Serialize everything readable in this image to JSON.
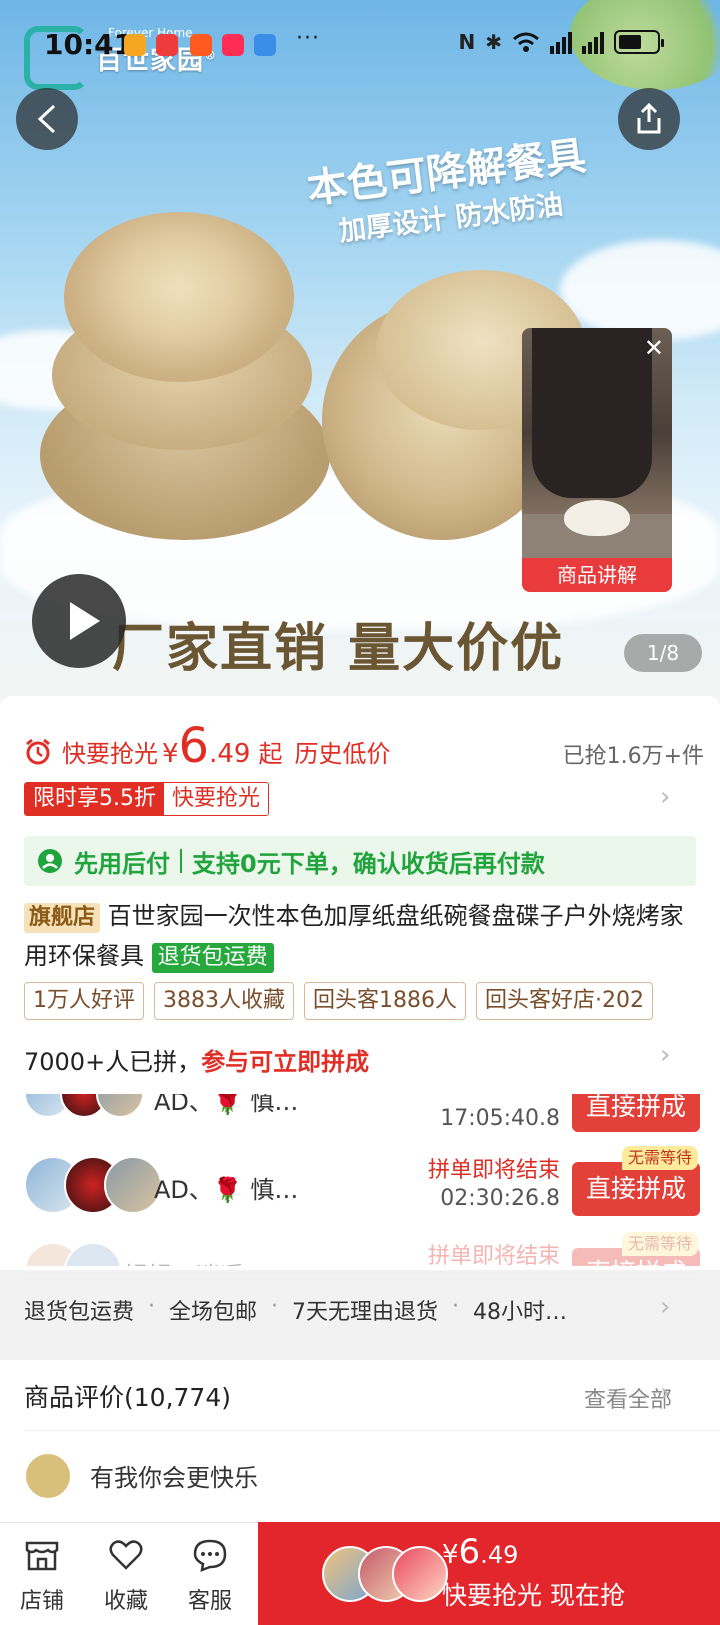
{
  "status_bar": {
    "time": "10:41",
    "overflow": "···"
  },
  "banner": {
    "brand_en": "Forever Home",
    "brand_cn": "百世家园",
    "brand_mark": "®",
    "headline": "本色可降解餐具",
    "subline": "加厚设计 防水防油",
    "bottom_slogan": "厂家直销 量大价优",
    "image_counter": "1/8",
    "video_label": "商品讲解"
  },
  "price": {
    "tag": "快要抢光",
    "currency": "¥",
    "int": "6",
    "dec": ".49",
    "suffix": "起",
    "history": "历史低价",
    "sold": "已抢1.6万+件"
  },
  "promo": {
    "discount": "限时享5.5折",
    "hurry": "快要抢光"
  },
  "pay_later": {
    "title": "先用后付",
    "desc": "支持0元下单，确认收货后再付款"
  },
  "product": {
    "flag": "旗舰店",
    "title": "百世家园一次性本色加厚纸盘纸碗餐盘碟子户外烧烤家用环保餐具",
    "return_tag": "退货包运费"
  },
  "stats": [
    "1万人好评",
    "3883人收藏",
    "回头客1886人",
    "回头客好店·202"
  ],
  "group_buy": {
    "count": "7000+人已拼，",
    "hint": "参与可立即拼成",
    "rows": [
      {
        "names": "AD、🌹 慎…",
        "end_text": "",
        "time": "17:05:40.8",
        "button": "直接拼成",
        "badge": ""
      },
      {
        "names": "AD、🌹 慎…",
        "end_text": "拼单即将结束",
        "time": "02:30:26.8",
        "button": "直接拼成",
        "badge": "无需等待"
      },
      {
        "names": "娟娟、逍遥",
        "end_text": "拼单即将结束",
        "time": "",
        "button": "直接拼成",
        "badge": "无需等待"
      }
    ]
  },
  "services": [
    "退货包运费",
    "全场包邮",
    "7天无理由退货",
    "48小时…"
  ],
  "reviews": {
    "title": "商品评价(10,774)",
    "see_all": "查看全部",
    "preview_user": "有我你会更快乐"
  },
  "bottom_bar": {
    "shop": "店铺",
    "favorite": "收藏",
    "service": "客服",
    "buy_price_currency": "¥",
    "buy_price_int": "6",
    "buy_price_dec": ".49",
    "buy_cta": "快要抢光 现在抢"
  },
  "colors": {
    "accent_red": "#e02e24",
    "pay_green": "#21a33d",
    "buy_red": "#e3262b"
  }
}
